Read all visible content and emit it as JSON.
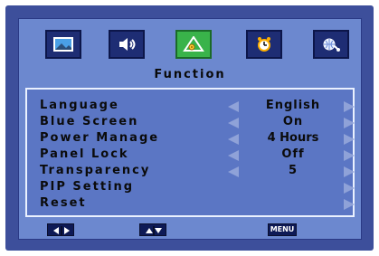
{
  "top_tabs": [
    {
      "name": "picture",
      "icon": "picture-icon",
      "active": false
    },
    {
      "name": "sound",
      "icon": "speaker-icon",
      "active": false
    },
    {
      "name": "function",
      "icon": "function-icon",
      "active": true
    },
    {
      "name": "timer",
      "icon": "alarm-clock-icon",
      "active": false
    },
    {
      "name": "setup",
      "icon": "globe-icon",
      "active": false
    }
  ],
  "menu": {
    "title": "Function",
    "items": [
      {
        "label": "Language",
        "value": "English"
      },
      {
        "label": "Blue Screen",
        "value": "On"
      },
      {
        "label": "Power Manage",
        "value": "4 Hours"
      },
      {
        "label": "Panel Lock",
        "value": "Off"
      },
      {
        "label": "Transparency",
        "value": "5"
      },
      {
        "label": "PIP Setting",
        "value": ""
      },
      {
        "label": "Reset",
        "value": ""
      }
    ]
  },
  "footer": {
    "menu_key": "MENU",
    "left_right_keys": "left-right-keys-icon",
    "up_down_keys": "up-down-keys-icon"
  },
  "colors": {
    "frame": "#3d4f9b",
    "panel": "#5b76c4",
    "active_tab": "#39b34a",
    "text": "#0b0b0b"
  }
}
